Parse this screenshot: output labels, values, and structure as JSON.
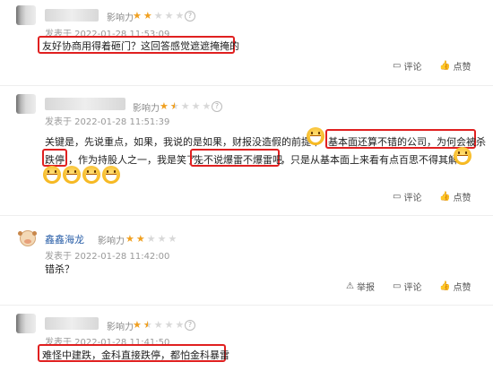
{
  "labels": {
    "influence": "影响力",
    "reply": "评论",
    "like": "点赞",
    "report": "举报"
  },
  "comments": [
    {
      "time": "发表于 2022-01-28 11:53:09",
      "stars": 2,
      "text": "友好协商用得着砸门？这回答感觉遮遮掩掩的"
    },
    {
      "time": "发表于 2022-01-28 11:51:39",
      "stars": 1.5,
      "line1": [
        "关键是，先说重点，如果，我说的是如果，财报没造假的前提下",
        "基本面还算不错的公司，为何会被杀"
      ],
      "line2": [
        "跌停",
        "，作为持股人之一，我是笑了，",
        "先不说爆雷不爆雷吧",
        "，只是从基本面上来看有点百思不得其解"
      ]
    },
    {
      "user": "鑫鑫海龙",
      "time": "发表于 2022-01-28 11:42:00",
      "stars": 2,
      "text": "错杀？"
    },
    {
      "time": "发表于 2022-01-28 11:41:50",
      "stars": 1.5,
      "text": "难怪中建跌，金科直接跌停，都怕金科暴雷"
    }
  ]
}
